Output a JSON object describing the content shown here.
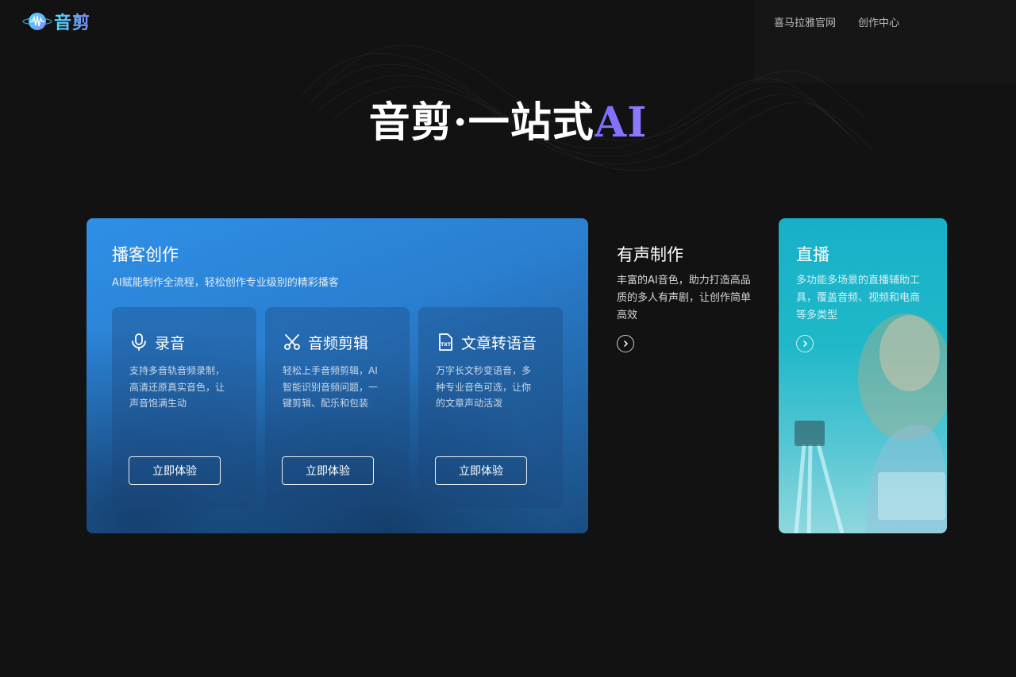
{
  "brand": {
    "name": "音剪"
  },
  "nav": {
    "items": [
      "喜马拉雅官网",
      "创作中心"
    ]
  },
  "hero": {
    "title_main": "音剪·一站式",
    "title_accent": "AI"
  },
  "podcast": {
    "title": "播客创作",
    "subtitle": "AI赋能制作全流程，轻松创作专业级别的精彩播客",
    "features": [
      {
        "icon": "microphone-icon",
        "title": "录音",
        "desc": "支持多音轨音频录制，高清还原真实音色，让声音饱满生动",
        "button": "立即体验"
      },
      {
        "icon": "scissors-icon",
        "title": "音频剪辑",
        "desc": "轻松上手音频剪辑，AI智能识别音频问题，一键剪辑、配乐和包装",
        "button": "立即体验"
      },
      {
        "icon": "txt-file-icon",
        "title": "文章转语音",
        "desc": "万字长文秒变语音，多种专业音色可选，让你的文章声动活泼",
        "button": "立即体验"
      }
    ]
  },
  "audio_production": {
    "title": "有声制作",
    "desc": "丰富的AI音色，助力打造高品质的多人有声剧，让创作简单高效"
  },
  "live": {
    "title": "直播",
    "desc": "多功能多场景的直播辅助工具，覆盖音频、视频和电商等多类型"
  },
  "colors": {
    "background": "#121212",
    "podcast_card": "#2f8fe6",
    "live_card": "#18b0c8",
    "accent": "#7a6cff"
  }
}
